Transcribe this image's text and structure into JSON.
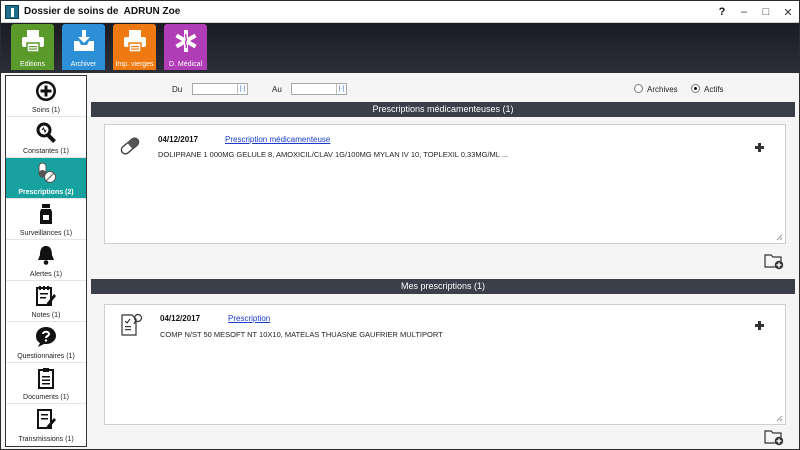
{
  "window": {
    "title": "Dossier de soins de  ADRUN Zoe",
    "controls": {
      "help": "?",
      "minimize": "–",
      "maximize": "□",
      "close": "✕"
    }
  },
  "toolbar": {
    "buttons": [
      {
        "label": "Editions",
        "color": "#5a9a2b",
        "icon": "printer-icon"
      },
      {
        "label": "Archiver",
        "color": "#2d8fd6",
        "icon": "archive-tray-icon"
      },
      {
        "label": "Imp. vierges",
        "color": "#f07a12",
        "icon": "printer-icon"
      },
      {
        "label": "D. Médical",
        "color": "#b03db5",
        "icon": "medical-star-icon"
      }
    ]
  },
  "sidebar": {
    "accent": "#17a2a0",
    "items": [
      {
        "label": "Soins (1)",
        "icon": "plus-circle-icon",
        "active": false
      },
      {
        "label": "Constantes (1)",
        "icon": "magnifier-icon",
        "active": false
      },
      {
        "label": "Prescriptions (2)",
        "icon": "pills-icon",
        "active": true
      },
      {
        "label": "Surveillances (1)",
        "icon": "bottle-icon",
        "active": false
      },
      {
        "label": "Alertes (1)",
        "icon": "bell-icon",
        "active": false
      },
      {
        "label": "Notes (1)",
        "icon": "notepad-icon",
        "active": false
      },
      {
        "label": "Questionnaires (1)",
        "icon": "question-bubble-icon",
        "active": false
      },
      {
        "label": "Documents (1)",
        "icon": "clipboard-icon",
        "active": false
      },
      {
        "label": "Transmissions (1)",
        "icon": "edit-document-icon",
        "active": false
      }
    ]
  },
  "filters": {
    "from_label": "Du",
    "from_value": "",
    "to_label": "Au",
    "to_value": "",
    "date_button": "[·]",
    "radio_archives": "Archives",
    "radio_actifs": "Actifs",
    "selected": "Actifs"
  },
  "sections": [
    {
      "header": "Prescriptions médicamenteuses (1)",
      "entry": {
        "date": "04/12/2017",
        "link": "Prescription médicamenteuse",
        "text": "DOLIPRANE 1 000MG GELULE 8, AMOXICIL/CLAV 1G/100MG MYLAN IV 10, TOPLEXIL 0,33MG/ML ..."
      }
    },
    {
      "header": "Mes prescriptions (1)",
      "entry": {
        "date": "04/12/2017",
        "link": "Prescription",
        "text": "COMP N/ST 50 MESOFT NT 10X10, MATELAS THUASNE GAUFRIER MULTIPORT"
      }
    }
  ]
}
